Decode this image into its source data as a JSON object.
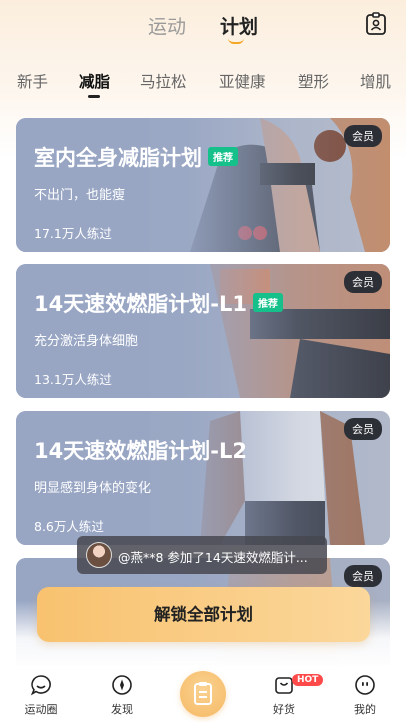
{
  "top_tabs": {
    "inactive": "运动",
    "active": "计划"
  },
  "categories": [
    "新手",
    "减脂",
    "马拉松",
    "亚健康",
    "塑形",
    "增肌"
  ],
  "cards": [
    {
      "title": "室内全身减脂计划",
      "badge": "推荐",
      "desc": "不出门，也能瘦",
      "count": "17.1万人练过",
      "vip": "会员"
    },
    {
      "title": "14天速效燃脂计划-L1",
      "badge": "推荐",
      "desc": "充分激活身体细胞",
      "count": "13.1万人练过",
      "vip": "会员"
    },
    {
      "title": "14天速效燃脂计划-L2",
      "badge": "",
      "desc": "明显感到身体的变化",
      "count": "8.6万人练过",
      "vip": "会员"
    },
    {
      "title": "",
      "badge": "",
      "desc": "",
      "count": "",
      "vip": "会员"
    }
  ],
  "toast": "@燕**8 参加了14天速效燃脂计...",
  "unlock_button": "解锁全部计划",
  "bottom_nav": [
    {
      "label": "运动圈",
      "icon": "chat-bubble-icon"
    },
    {
      "label": "发现",
      "icon": "compass-icon"
    },
    {
      "label": "",
      "icon": "clipboard-icon"
    },
    {
      "label": "好货",
      "icon": "shopping-bag-icon",
      "badge": "HOT"
    },
    {
      "label": "我的",
      "icon": "face-icon"
    }
  ],
  "colors": {
    "accent": "#f5a623",
    "badge_green": "#16c08a",
    "card_bg": "#9aa8c6",
    "hot": "#ff4a4a"
  }
}
